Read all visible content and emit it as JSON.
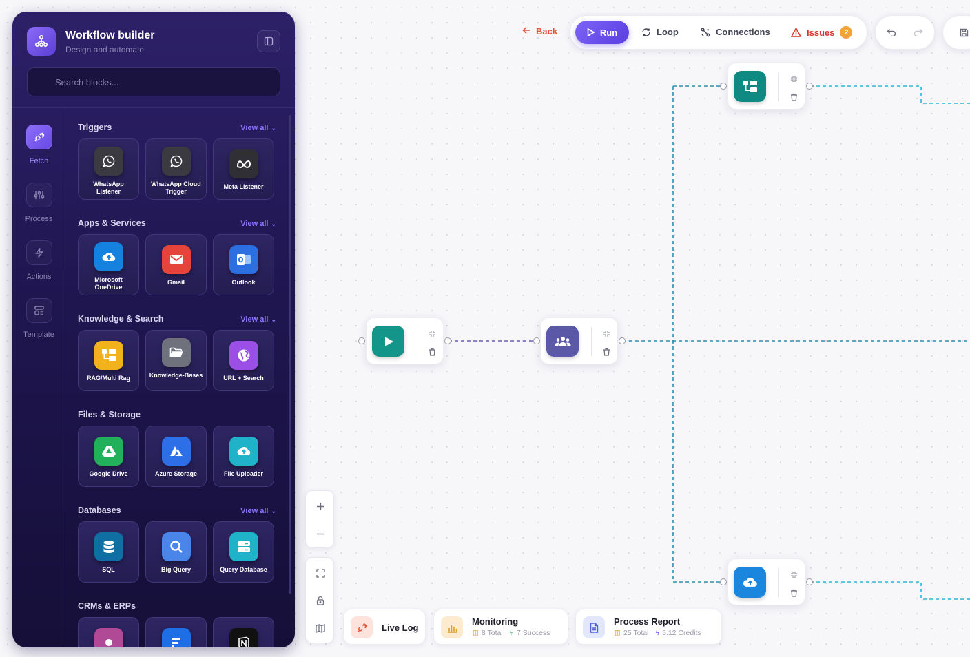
{
  "sidebar": {
    "title": "Workflow builder",
    "subtitle": "Design and automate",
    "search_placeholder": "Search blocks...",
    "rail": [
      {
        "label": "Fetch",
        "icon": "plug-icon",
        "active": true
      },
      {
        "label": "Process",
        "icon": "sliders-icon",
        "active": false
      },
      {
        "label": "Actions",
        "icon": "bolt-icon",
        "active": false
      },
      {
        "label": "Template",
        "icon": "template-icon",
        "active": false
      }
    ],
    "sections": [
      {
        "title": "Triggers",
        "view_all": "View all",
        "cards": [
          {
            "label": "WhatsApp Listener",
            "icon": "whatsapp-icon",
            "color": "#3a3a40"
          },
          {
            "label": "WhatsApp Cloud Trigger",
            "icon": "whatsapp-icon",
            "color": "#3a3a40"
          },
          {
            "label": "Meta Listener",
            "icon": "meta-icon",
            "color": "#2f2f35"
          }
        ]
      },
      {
        "title": "Apps & Services",
        "view_all": "View all",
        "cards": [
          {
            "label": "Microsoft OneDrive",
            "icon": "onedrive-icon",
            "color": "#1682e0"
          },
          {
            "label": "Gmail",
            "icon": "gmail-icon",
            "color": "#e5443a"
          },
          {
            "label": "Outlook",
            "icon": "outlook-icon",
            "color": "#2b6fe0"
          }
        ]
      },
      {
        "title": "Knowledge & Search",
        "view_all": "View all",
        "cards": [
          {
            "label": "RAG/Multi Rag",
            "icon": "rag-icon",
            "color": "#f1b21c"
          },
          {
            "label": "Knowledge-Bases",
            "icon": "folder-icon",
            "color": "#6f727c"
          },
          {
            "label": "URL + Search",
            "icon": "globe-icon",
            "color": "#9b4fe6"
          }
        ]
      },
      {
        "title": "Files & Storage",
        "view_all": "",
        "cards": [
          {
            "label": "Google Drive",
            "icon": "google-drive-icon",
            "color": "#22b05a"
          },
          {
            "label": "Azure Storage",
            "icon": "azure-icon",
            "color": "#2d6fe6"
          },
          {
            "label": "File Uploader",
            "icon": "cloud-upload-icon",
            "color": "#1fb2c9"
          }
        ]
      },
      {
        "title": "Databases",
        "view_all": "View all",
        "cards": [
          {
            "label": "SQL",
            "icon": "database-icon",
            "color": "#0f6fa3"
          },
          {
            "label": "Big Query",
            "icon": "search-icon",
            "color": "#4a86ea"
          },
          {
            "label": "Query Database",
            "icon": "server-icon",
            "color": "#1fb2c9"
          }
        ]
      },
      {
        "title": "CRMs & ERPs",
        "view_all": "",
        "cards": [
          {
            "label": "",
            "icon": "crm-icon",
            "color": "#b04a96"
          },
          {
            "label": "",
            "icon": "erp-icon",
            "color": "#1e6fe6"
          },
          {
            "label": "",
            "icon": "notion-icon",
            "color": "#111111"
          }
        ]
      }
    ]
  },
  "toolbar": {
    "back": "Back",
    "run": "Run",
    "loop": "Loop",
    "connections": "Connections",
    "issues": "Issues",
    "issues_count": "2"
  },
  "canvas": {
    "nodes": [
      {
        "name": "start-node",
        "icon": "play-icon",
        "color": "#14958a"
      },
      {
        "name": "team-node",
        "icon": "users-icon",
        "color": "#5b58a8"
      },
      {
        "name": "rag-node",
        "icon": "rag-icon",
        "color": "#0f8a82"
      },
      {
        "name": "upload-node",
        "icon": "cloud-upload-icon",
        "color": "#1a86dd"
      }
    ],
    "edge_colors": {
      "primary": "#6e5ab8",
      "secondary": "#2c8fb0",
      "tertiary": "#29b7d6"
    }
  },
  "status": {
    "live_log": {
      "title": "Live Log"
    },
    "monitoring": {
      "title": "Monitoring",
      "total": "8 Total",
      "success": "7 Success"
    },
    "report": {
      "title": "Process Report",
      "total": "25 Total",
      "credits": "5.12 Credits"
    }
  },
  "colors": {
    "accent": "#6b4ef0",
    "danger": "#e4553e",
    "warning": "#f2a33a"
  }
}
